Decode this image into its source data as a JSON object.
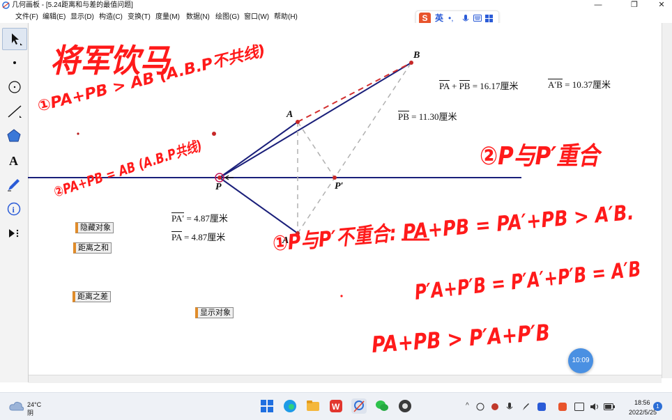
{
  "window": {
    "title": "几何画板 - [5.24距离和与差的最值问题]",
    "minimize": "—",
    "maximize": "❐",
    "close": "✕"
  },
  "menu": [
    "文件(F)",
    "编辑(E)",
    "显示(D)",
    "构造(C)",
    "变换(T)",
    "度量(M)",
    "数据(N)",
    "绘图(G)",
    "窗口(W)",
    "帮助(H)"
  ],
  "ime": {
    "logo": "S",
    "mode": "英"
  },
  "tools": [
    "arrow-tool",
    "point-tool",
    "compass-tool",
    "line-tool",
    "polygon-tool",
    "text-tool",
    "marker-tool",
    "info-tool",
    "custom-tool"
  ],
  "measurements": {
    "sum": "PA + PB = 16.17厘米",
    "sum_left": "PA",
    "sum_plus": "+",
    "sum_right": "PB",
    "sum_value": "= 16.17厘米",
    "apb_bar": "A′B",
    "apb_value": "= 10.37厘米",
    "pb_bar": "PB",
    "pb_value": "= 11.30厘米",
    "paprime_bar": "PA′",
    "paprime_value": "= 4.87厘米",
    "pa_bar": "PA",
    "pa_value": "= 4.87厘米"
  },
  "points": {
    "A": "A",
    "B": "B",
    "P": "P",
    "Pprime": "P′",
    "Aprime": "A′"
  },
  "buttons": {
    "hide": "隐藏对象",
    "sum": "距离之和",
    "diff": "距离之差",
    "show": "显示对象"
  },
  "handwriting": {
    "title": "将军饮马",
    "line1": "①PA+PB > AB (A.B.P不共线)",
    "line2": "②PA+PB = AB (A.B.P共线)",
    "line3": "②P与P′重合",
    "line4": "①P与P′不重合: PA+PB = PA′+PB > A′B.",
    "line5": "P′A+P′B = P′A′+P′B = A′B",
    "line6": "P′A+P′B = P′A′+P′B",
    "line7": "PA+PB > P′A+P′B"
  },
  "clock_bubble": "10:09",
  "taskbar": {
    "temperature": "24°C",
    "condition": "阴",
    "time": "18:56",
    "date": "2022/5/25",
    "notifications": "1"
  },
  "colors": {
    "construction": "#1a1f7a",
    "dashed": "#b0b0b0",
    "point": "#c62828",
    "ink": "#ff1a1a",
    "accent": "#e08c2a"
  }
}
